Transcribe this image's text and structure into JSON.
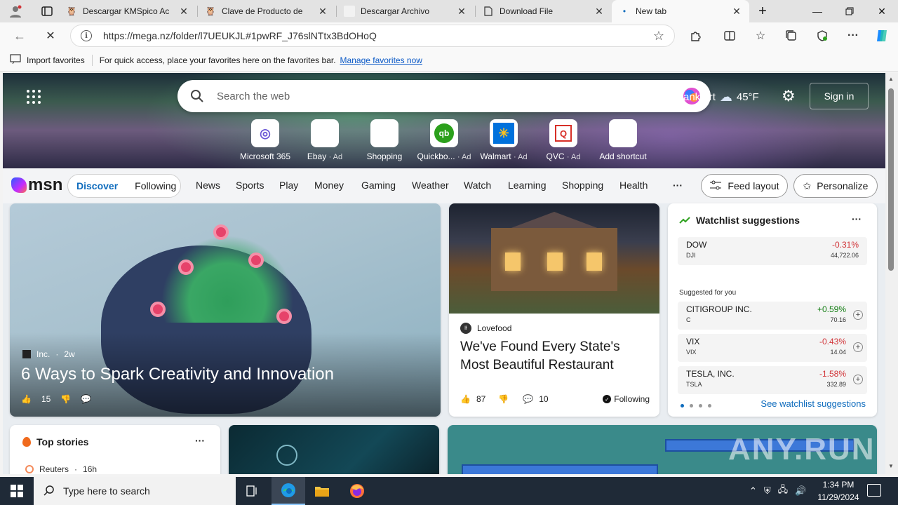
{
  "tabs": [
    {
      "title": "Descargar KMSpico Ac",
      "icon": "🦉"
    },
    {
      "title": "Clave de Producto de",
      "icon": "🦉"
    },
    {
      "title": "Descargar Archivo",
      "icon": ""
    },
    {
      "title": "Download File",
      "icon": "🗋"
    },
    {
      "title": "New tab",
      "icon": "•",
      "active": true
    }
  ],
  "address": {
    "url": "https://mega.nz/folder/l7UEUKJL#1pwRF_J76slNTtx3BdOHoQ"
  },
  "favbar": {
    "import_label": "Import favorites",
    "hint": "For quick access, place your favorites here on the favorites bar.",
    "manage_link": "Manage favorites now"
  },
  "newtab": {
    "search_placeholder": "Search the web",
    "weather_city_partial": "ankfurt",
    "temperature": "45°F",
    "signin": "Sign in",
    "shortcuts": [
      {
        "label": "Microsoft 365",
        "ad": "",
        "icon": "◎",
        "color": "#6a57d6"
      },
      {
        "label": "Ebay",
        "ad": "· Ad",
        "icon": "🛍",
        "color": "#e53238"
      },
      {
        "label": "Shopping",
        "ad": "",
        "icon": "🏷",
        "color": "#333333"
      },
      {
        "label": "Quickbo...",
        "ad": "· Ad",
        "icon": "qb",
        "color": "#2ca01c"
      },
      {
        "label": "Walmart",
        "ad": "· Ad",
        "icon": "✳",
        "color": "#0071dc"
      },
      {
        "label": "QVC",
        "ad": "· Ad",
        "icon": "Q",
        "color": "#d72f27"
      },
      {
        "label": "Add shortcut",
        "ad": "",
        "icon": "+",
        "color": "#333333"
      }
    ]
  },
  "msn": {
    "logo": "msn",
    "tabs": [
      "Discover",
      "Following"
    ],
    "nav": [
      "News",
      "Sports",
      "Play",
      "Money",
      "Gaming",
      "Weather",
      "Watch",
      "Learning",
      "Shopping",
      "Health"
    ],
    "more": "···",
    "feed_layout": "Feed layout",
    "personalize": "Personalize"
  },
  "hero_card": {
    "source": "Inc.",
    "age": "2w",
    "headline": "6 Ways to Spark Creativity and Innovation",
    "likes": "15"
  },
  "food_card": {
    "source": "Lovefood",
    "headline": "We've Found Every State's Most Beautiful Restaurant",
    "likes": "87",
    "comments": "10",
    "following": "Following"
  },
  "watchlist": {
    "title": "Watchlist suggestions",
    "more": "···",
    "main": {
      "name": "DOW",
      "ticker": "DJI",
      "change": "-0.31%",
      "price": "44,722.06",
      "dir": "neg"
    },
    "suggested_label": "Suggested for you",
    "items": [
      {
        "name": "CITIGROUP INC.",
        "ticker": "C",
        "change": "+0.59%",
        "price": "70.16",
        "dir": "pos"
      },
      {
        "name": "VIX",
        "ticker": "VIX",
        "change": "-0.43%",
        "price": "14.04",
        "dir": "neg"
      },
      {
        "name": "TESLA, INC.",
        "ticker": "TSLA",
        "change": "-1.58%",
        "price": "332.89",
        "dir": "neg"
      }
    ],
    "see_more": "See watchlist suggestions"
  },
  "top_stories": {
    "title": "Top stories",
    "more": "···",
    "source": "Reuters",
    "age": "16h"
  },
  "watermark": "ANY.RUN",
  "taskbar": {
    "search_placeholder": "Type here to search",
    "time": "1:34 PM",
    "date": "11/29/2024"
  }
}
